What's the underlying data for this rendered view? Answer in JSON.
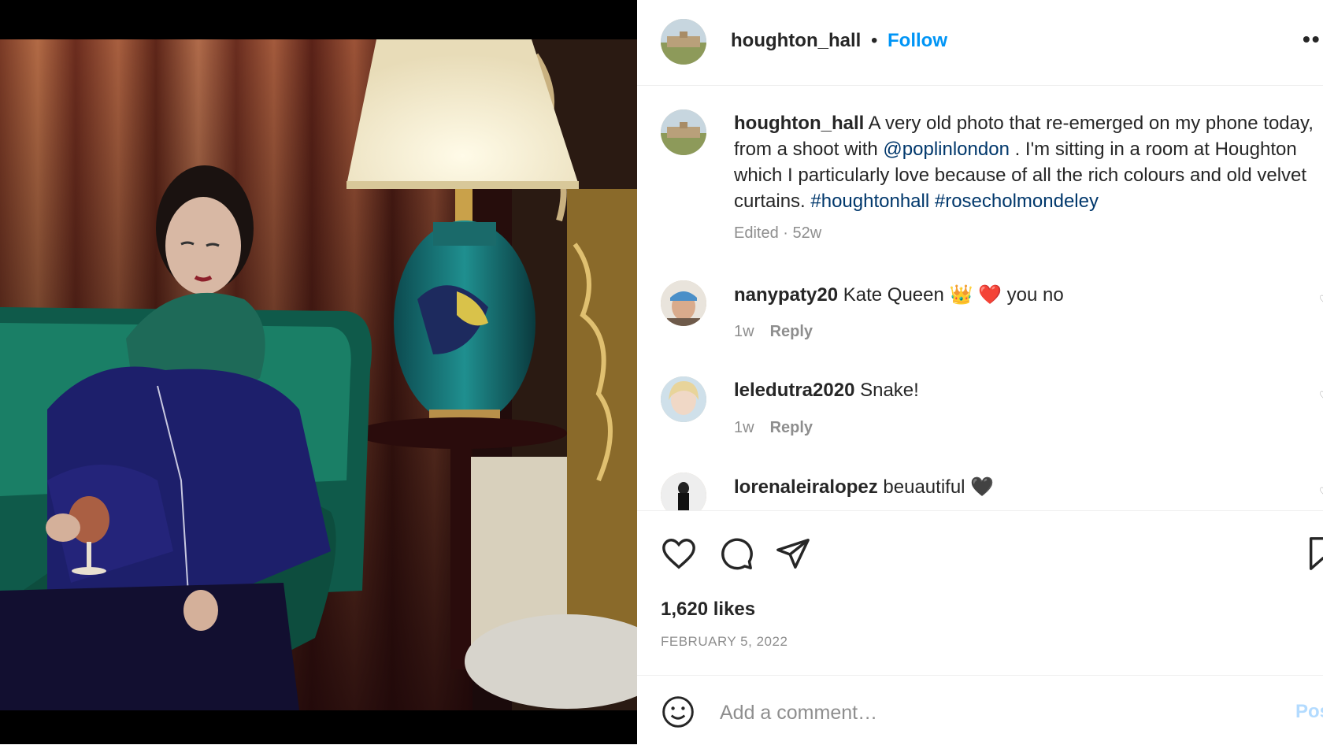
{
  "post": {
    "username": "houghton_hall",
    "separator": "•",
    "follow_label": "Follow",
    "more_label": "••"
  },
  "caption": {
    "username": "houghton_hall",
    "text_part1": "A very old photo that re-emerged on my phone today, from a shoot with",
    "mention": "@poplinlondon",
    "text_part2": ". I'm sitting in a room at Houghton which I particularly love because of all the rich colours and old velvet curtains.",
    "hashtag1": "#houghtonhall",
    "hashtag2": "#rosecholmondeley",
    "meta": "Edited · 52w"
  },
  "comments": [
    {
      "username": "nanypaty20",
      "text": "Kate Queen 👑 ❤️ you no",
      "time": "1w",
      "reply": "Reply"
    },
    {
      "username": "leledutra2020",
      "text": "Snake!",
      "time": "1w",
      "reply": "Reply"
    },
    {
      "username": "lorenaleiralopez",
      "text": "beuautiful 🖤",
      "time": "",
      "reply": ""
    }
  ],
  "likes": "1,620 likes",
  "date": "FEBRUARY 5, 2022",
  "add_comment": {
    "placeholder": "Add a comment…",
    "post_label": "Pos"
  },
  "icons": {
    "like": "heart-icon",
    "comment": "comment-bubble-icon",
    "share": "paper-plane-icon",
    "save": "bookmark-icon",
    "emoji": "smiley-icon",
    "more": "ellipsis-icon"
  },
  "colors": {
    "accent": "#0095f6",
    "link": "#00376b",
    "muted": "#8e8e8e",
    "text": "#262626"
  }
}
